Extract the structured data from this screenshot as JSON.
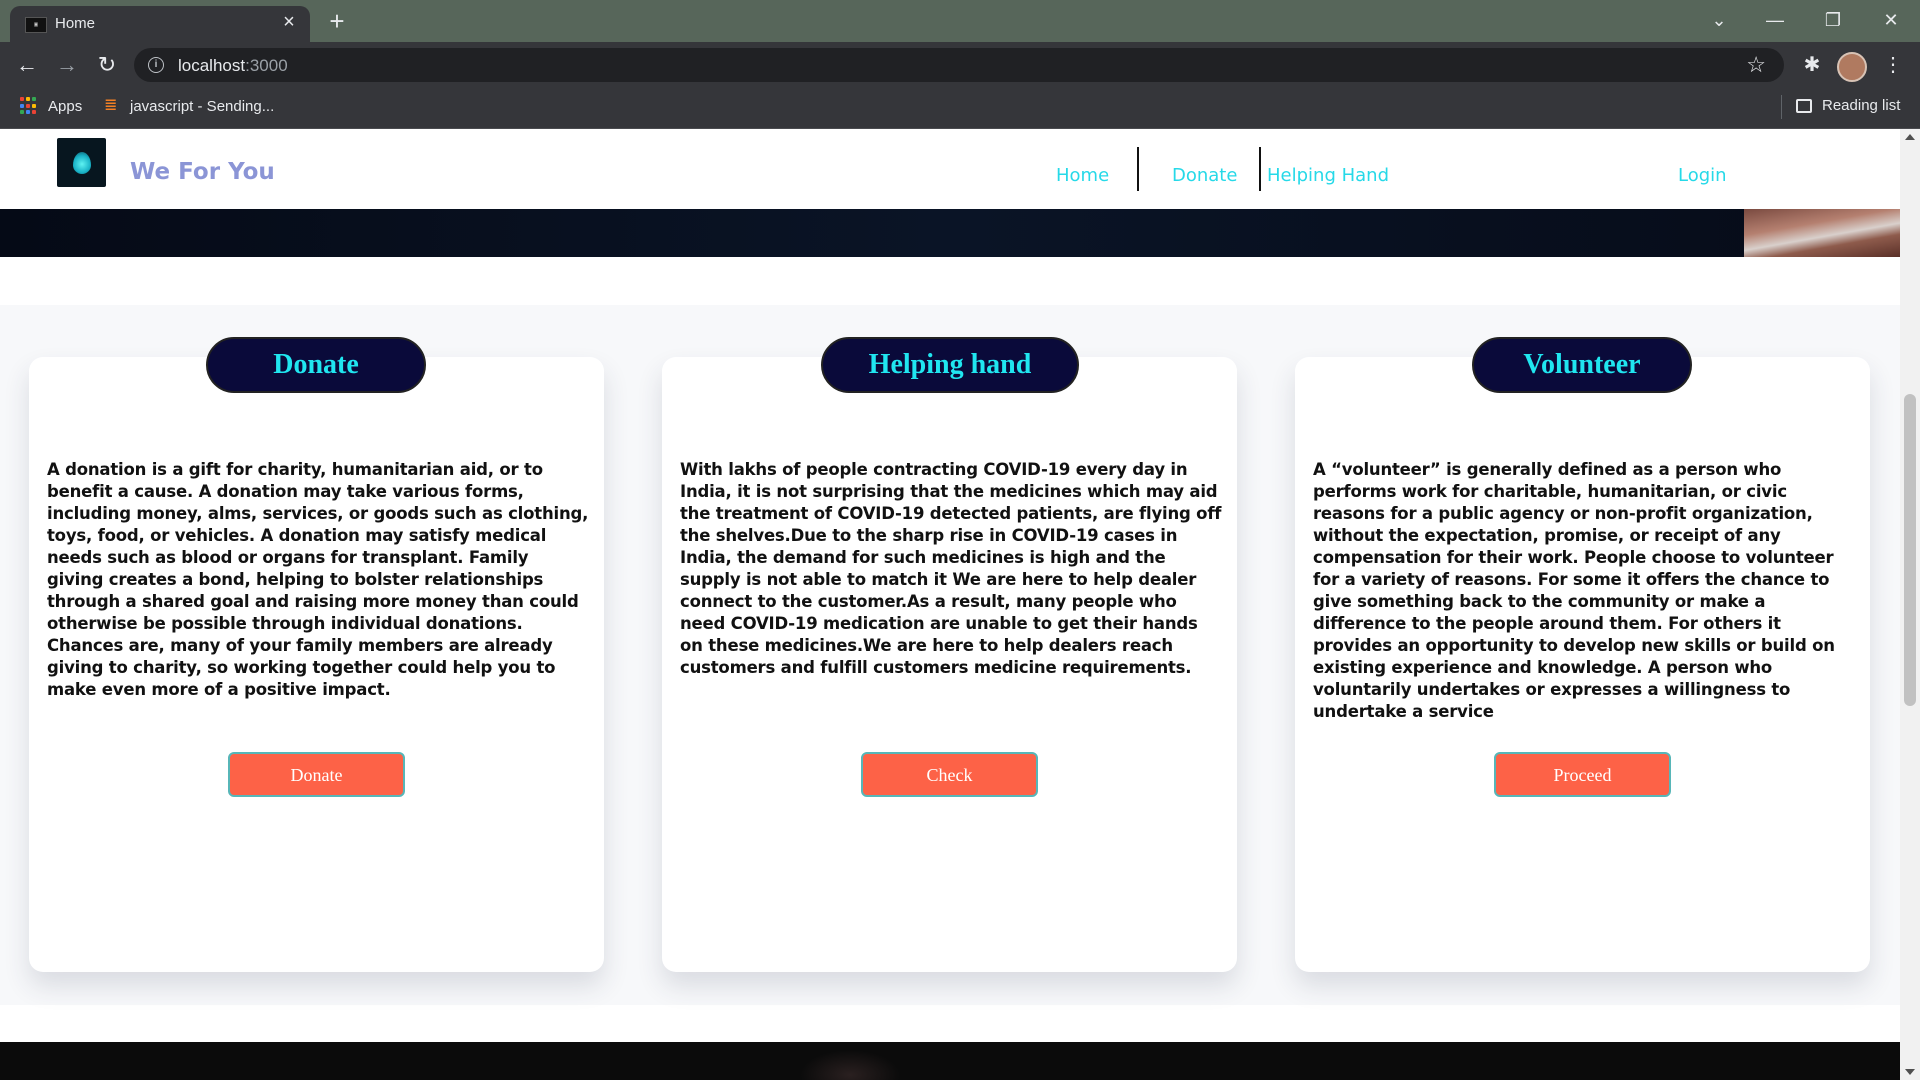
{
  "browser": {
    "tab_title": "Home",
    "url_host": "localhost",
    "url_port": ":3000",
    "bookmarks": [
      {
        "label": "Apps"
      },
      {
        "label": "javascript - Sending..."
      }
    ],
    "reading_list": "Reading list"
  },
  "site": {
    "brand": "We For You",
    "nav": {
      "home": "Home",
      "donate": "Donate",
      "helping_hand": "Helping Hand",
      "login": "Login"
    }
  },
  "cards": [
    {
      "title": "Donate",
      "text": "A donation is a gift for charity, humanitarian aid, or to benefit a cause. A donation may take various forms, including money, alms, services, or goods such as clothing, toys, food, or vehicles. A donation may satisfy medical needs such as blood or organs for transplant. Family giving creates a bond, helping to bolster relationships through a shared goal and raising more money than could otherwise be possible through individual donations. Chances are, many of your family members are already giving to charity, so working together could help you to make even more of a positive impact.",
      "button": "Donate"
    },
    {
      "title": "Helping hand",
      "text": "With lakhs of people contracting COVID-19 every day in India, it is not surprising that the medicines which may aid the treatment of COVID-19 detected patients, are flying off the shelves.Due to the sharp rise in COVID-19 cases in India, the demand for such medicines is high and the supply is not able to match it We are here to help dealer connect to the customer.As a result, many people who need COVID-19 medication are unable to get their hands on these medicines.We are here to help dealers reach customers and fulfill customers medicine requirements.",
      "button": "Check"
    },
    {
      "title": "Volunteer",
      "text": "A “volunteer” is generally defined as a person who performs work for charitable, humanitarian, or civic reasons for a public agency or non-profit organization, without the expectation, promise, or receipt of any compensation for their work. People choose to volunteer for a variety of reasons. For some it offers the chance to give something back to the community or make a difference to the people around them. For others it provides an opportunity to develop new skills or build on existing experience and knowledge. A person who voluntarily undertakes or expresses a willingness to undertake a service",
      "button": "Proceed"
    }
  ],
  "colors": {
    "chrome_titlebar": "#57665a",
    "chrome_toolbar": "#35363a",
    "nav_link": "#26d9e8",
    "brand": "#8b95d6",
    "pill_bg": "#0a0a3a",
    "pill_text": "#20e6f0",
    "button_bg": "#fd6247",
    "button_border": "#57b6b8"
  },
  "icons": {
    "back": "arrow-left-icon",
    "forward": "arrow-right-icon",
    "reload": "reload-icon",
    "info": "info-icon",
    "bookmark": "star-icon",
    "extensions": "puzzle-icon",
    "menu": "kebab-menu-icon",
    "apps": "apps-grid-icon",
    "reading_list": "reading-list-icon"
  }
}
